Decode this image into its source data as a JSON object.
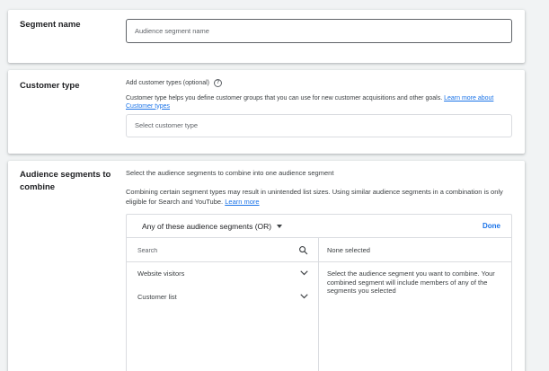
{
  "segment_name": {
    "title": "Segment name",
    "input_placeholder": "Audience segment name"
  },
  "customer_type": {
    "title": "Customer type",
    "optional_label": "Add customer types (optional)",
    "help_icon": "question-circle-icon",
    "description": "Customer type helps you define customer groups that you can use for new customer acquisitions and other goals.",
    "learn_more": "Learn more about Customer types",
    "select_placeholder": "Select customer type"
  },
  "audience": {
    "title": "Audience segments to combine",
    "intro": "Select the audience segments to combine into one audience segment",
    "note": "Combining certain segment types may result in unintended list sizes. Using similar audience segments in a combination is only eligible for Search and YouTube.",
    "learn_more": "Learn more",
    "mode_label": "Any of these audience segments (OR)",
    "done_label": "Done",
    "search_placeholder": "Search",
    "search_icon": "search-icon",
    "segments": [
      {
        "label": "Website visitors",
        "icon": "chevron-down-icon"
      },
      {
        "label": "Customer list",
        "icon": "chevron-down-icon"
      }
    ],
    "none_selected": "None selected",
    "right_description": "Select the audience segment you want to combine. Your combined segment will include members of any of the segments you selected"
  },
  "colors": {
    "accent": "#1a73e8",
    "background": "#f1f3f4",
    "border": "#dadce0"
  }
}
